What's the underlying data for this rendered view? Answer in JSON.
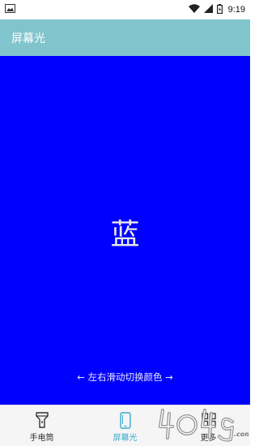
{
  "status_bar": {
    "time": "9:19",
    "icons": [
      "image-icon",
      "wifi-icon",
      "signal-icon",
      "battery-icon"
    ]
  },
  "app_bar": {
    "title": "屏幕光"
  },
  "screen": {
    "color_name": "蓝",
    "background_color": "#0000ff",
    "hint": "← 左右滑动切换颜色 →"
  },
  "bottom_nav": {
    "active_color": "#3aa9cc",
    "items": [
      {
        "label": "手电筒",
        "icon": "flashlight-icon"
      },
      {
        "label": "屏幕光",
        "icon": "phone-screen-icon"
      },
      {
        "label": "更多",
        "icon": "grid-icon"
      }
    ]
  },
  "watermark": {
    "text": "4049.com"
  }
}
